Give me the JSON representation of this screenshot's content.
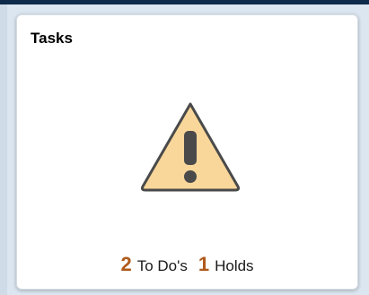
{
  "tile": {
    "title": "Tasks",
    "icon": "warning-triangle-icon",
    "todos_count": "2",
    "todos_label": "To Do's",
    "holds_count": "1",
    "holds_label": "Holds"
  },
  "colors": {
    "icon_fill": "#f9d79a",
    "icon_stroke": "#4a4a4a",
    "count_color": "#b05a1b",
    "top_bar": "#0d2a4a"
  }
}
